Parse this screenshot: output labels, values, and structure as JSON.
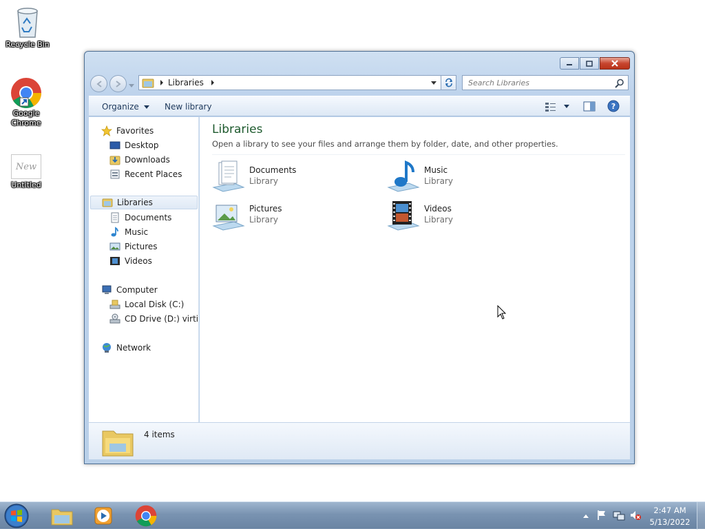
{
  "desktop": {
    "icons": [
      {
        "label": "Recycle Bin"
      },
      {
        "label": "Google Chrome"
      },
      {
        "label": "Untitled",
        "thumb_text": "New"
      }
    ]
  },
  "window": {
    "address": {
      "crumbs": [
        "Libraries"
      ]
    },
    "search": {
      "placeholder": "Search Libraries"
    },
    "toolbar": {
      "organize_label": "Organize",
      "new_library_label": "New library"
    },
    "nav": {
      "favorites": {
        "label": "Favorites",
        "items": [
          "Desktop",
          "Downloads",
          "Recent Places"
        ]
      },
      "libraries": {
        "label": "Libraries",
        "items": [
          "Documents",
          "Music",
          "Pictures",
          "Videos"
        ]
      },
      "computer": {
        "label": "Computer",
        "items": [
          "Local Disk (C:)",
          "CD Drive (D:) virtio-w"
        ]
      },
      "network": {
        "label": "Network"
      }
    },
    "content": {
      "title": "Libraries",
      "description": "Open a library to see your files and arrange them by folder, date, and other properties.",
      "libraries": [
        {
          "name": "Documents",
          "type": "Library",
          "icon": "documents-library-icon"
        },
        {
          "name": "Music",
          "type": "Library",
          "icon": "music-library-icon"
        },
        {
          "name": "Pictures",
          "type": "Library",
          "icon": "pictures-library-icon"
        },
        {
          "name": "Videos",
          "type": "Library",
          "icon": "videos-library-icon"
        }
      ]
    },
    "details": {
      "count_text": "4 items"
    }
  },
  "taskbar": {
    "clock": {
      "time": "2:47 AM",
      "date": "5/13/2022"
    }
  },
  "colors": {
    "title_green": "#1e5a2e",
    "selection": "#dfe9f5",
    "taskbar": "#7993b1"
  }
}
